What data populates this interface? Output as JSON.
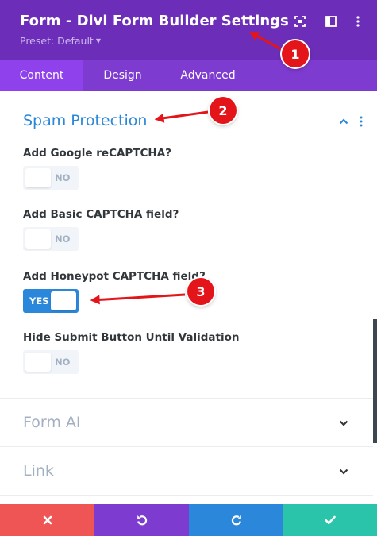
{
  "header": {
    "title": "Form - Divi Form Builder Settings",
    "preset": "Preset: Default",
    "icons": [
      "expand-icon",
      "sidebar-icon",
      "more-options-icon"
    ],
    "bg_color": "#6c2eb9"
  },
  "tabs": [
    {
      "label": "Content",
      "active": true
    },
    {
      "label": "Design",
      "active": false
    },
    {
      "label": "Advanced",
      "active": false
    }
  ],
  "section": {
    "title": "Spam Protection",
    "fields": [
      {
        "label": "Add Google reCAPTCHA?",
        "state": "NO"
      },
      {
        "label": "Add Basic CAPTCHA field?",
        "state": "NO"
      },
      {
        "label": "Add Honeypot CAPTCHA field?",
        "state": "YES"
      },
      {
        "label": "Hide Submit Button Until Validation",
        "state": "NO"
      }
    ]
  },
  "collapsed_sections": [
    {
      "title": "Form AI"
    },
    {
      "title": "Link"
    }
  ],
  "annotations": [
    "1",
    "2",
    "3"
  ],
  "footer": {
    "buttons": [
      {
        "name": "discard",
        "icon": "close-icon",
        "color": "#ef5555"
      },
      {
        "name": "undo",
        "icon": "undo-icon",
        "color": "#7e3bd0"
      },
      {
        "name": "redo",
        "icon": "redo-icon",
        "color": "#2b87da"
      },
      {
        "name": "save",
        "icon": "check-icon",
        "color": "#29c4a9"
      }
    ]
  },
  "colors": {
    "accent": "#2b87da",
    "tab_bar": "#7e3bd0",
    "active_tab": "#8f42ec",
    "annotation": "#e3151a"
  }
}
